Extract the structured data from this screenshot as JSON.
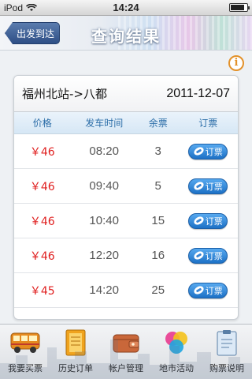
{
  "status_bar": {
    "carrier": "iPod",
    "time": "14:24",
    "battery_level": 0.85
  },
  "nav": {
    "back_label": "出发到达",
    "title": "查询结果"
  },
  "route": {
    "label": "福州北站->八都",
    "date": "2011-12-07"
  },
  "table": {
    "headers": [
      "价格",
      "发车时间",
      "余票",
      "订票"
    ],
    "rows": [
      {
        "price": "￥46",
        "time": "08:20",
        "remaining": "3",
        "order_label": "订票"
      },
      {
        "price": "￥46",
        "time": "09:40",
        "remaining": "5",
        "order_label": "订票"
      },
      {
        "price": "￥46",
        "time": "10:40",
        "remaining": "15",
        "order_label": "订票"
      },
      {
        "price": "￥46",
        "time": "12:20",
        "remaining": "16",
        "order_label": "订票"
      },
      {
        "price": "￥45",
        "time": "14:20",
        "remaining": "25",
        "order_label": "订票"
      }
    ]
  },
  "tabs": [
    {
      "label": "我要买票",
      "icon": "bus-icon"
    },
    {
      "label": "历史订单",
      "icon": "notebook-icon"
    },
    {
      "label": "帐户管理",
      "icon": "wallet-icon"
    },
    {
      "label": "地市活动",
      "icon": "color-circles-icon"
    },
    {
      "label": "购票说明",
      "icon": "clipboard-icon"
    }
  ],
  "colors": {
    "accent_blue": "#2c6ea8",
    "price_red": "#e02020",
    "info_orange": "#e3922b"
  }
}
